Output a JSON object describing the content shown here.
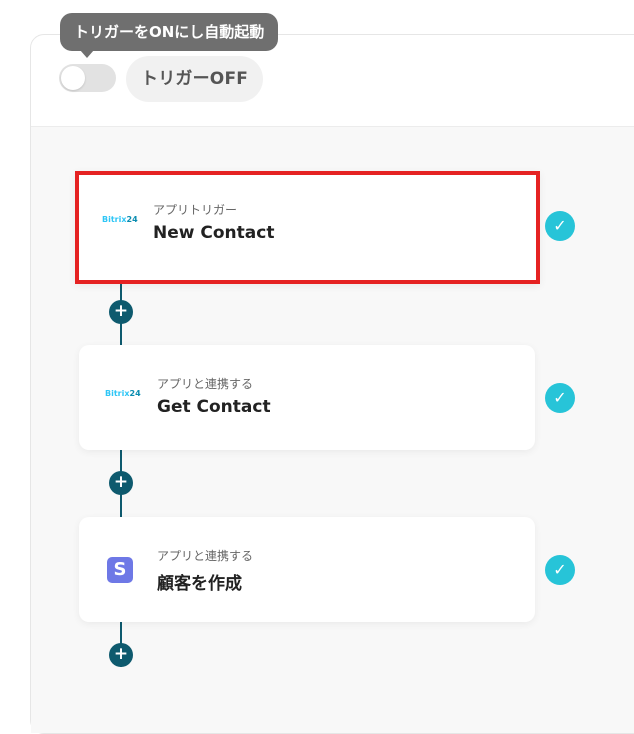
{
  "trigger": {
    "tooltip": "トリガーをONにし自動起動",
    "state_label": "トリガーOFF",
    "enabled": false
  },
  "flow": {
    "steps": [
      {
        "app_logo": "Bitrix24",
        "app_logo_name": "Bitrix",
        "app_logo_num": "24",
        "kicker": "アプリトリガー",
        "title": "New Contact",
        "status": "complete",
        "selected": true
      },
      {
        "app_logo": "Bitrix24",
        "app_logo_name": "Bitrix",
        "app_logo_num": "24",
        "kicker": "アプリと連携する",
        "title": "Get Contact",
        "status": "complete",
        "selected": false
      },
      {
        "app_logo": "S",
        "kicker": "アプリと連携する",
        "title": "顧客を作成",
        "status": "complete",
        "selected": false
      }
    ],
    "add_symbol": "+",
    "check_symbol": "✓"
  },
  "colors": {
    "accent": "#0e5a6e",
    "check": "#27c4d8",
    "selected_border": "#e52222",
    "stripe": "#6e78e6",
    "bitrix": "#2fc6f6"
  }
}
